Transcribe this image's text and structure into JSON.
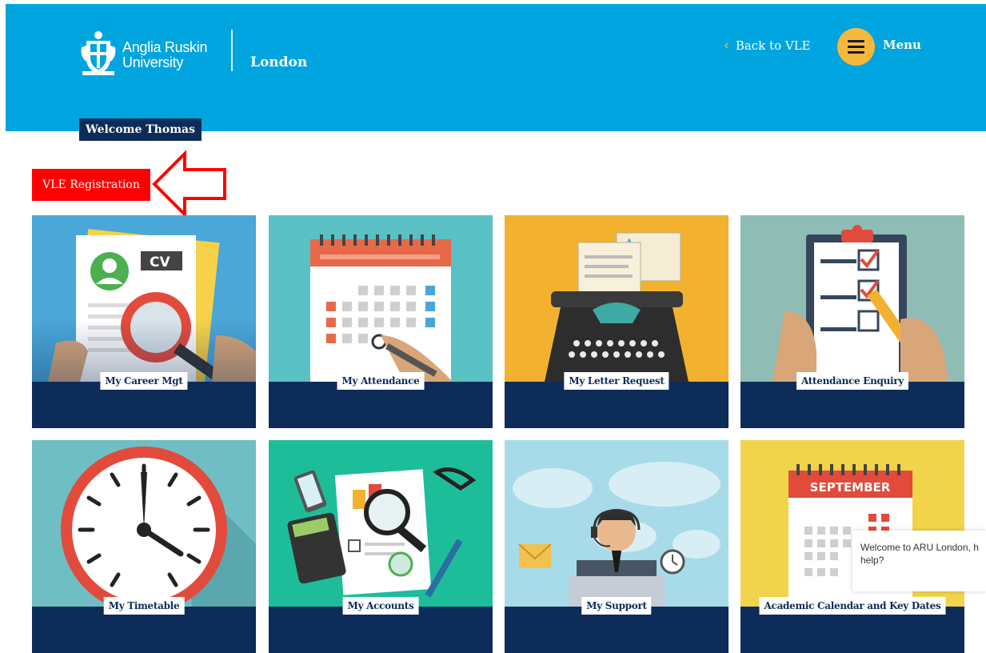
{
  "header": {
    "logo_line1": "Anglia Ruskin",
    "logo_line2": "University",
    "campus": "London",
    "back_label": "Back to VLE",
    "back_icon": "chevron-left-icon",
    "menu_label": "Menu",
    "menu_icon": "hamburger-icon",
    "background": "#00a5df",
    "accent": "#f5b83a"
  },
  "welcome": "Welcome Thomas",
  "vle_registration": {
    "label": "VLE Registration",
    "color": "#ff0000",
    "annotation_icon": "arrow-left-outline-icon"
  },
  "tiles": [
    {
      "label": "My Career Mgt",
      "icon": "cv-magnifier-icon"
    },
    {
      "label": "My Attendance",
      "icon": "calendar-pen-icon"
    },
    {
      "label": "My Letter Request",
      "icon": "typewriter-icon"
    },
    {
      "label": "Attendance Enquiry",
      "icon": "clipboard-checklist-icon"
    },
    {
      "label": "My Timetable",
      "icon": "clock-icon"
    },
    {
      "label": "My Accounts",
      "icon": "accounts-calculator-icon"
    },
    {
      "label": "My Support",
      "icon": "support-agent-icon"
    },
    {
      "label": "Academic Calendar and Key Dates",
      "icon": "september-calendar-icon"
    }
  ],
  "calendar_month": "SEPTEMBER",
  "cv_text": "CV",
  "letter_text": "A",
  "chat_popup": "Welcome to ARU London, h\nhelp?",
  "tile_band_color": "#0d2c5a"
}
